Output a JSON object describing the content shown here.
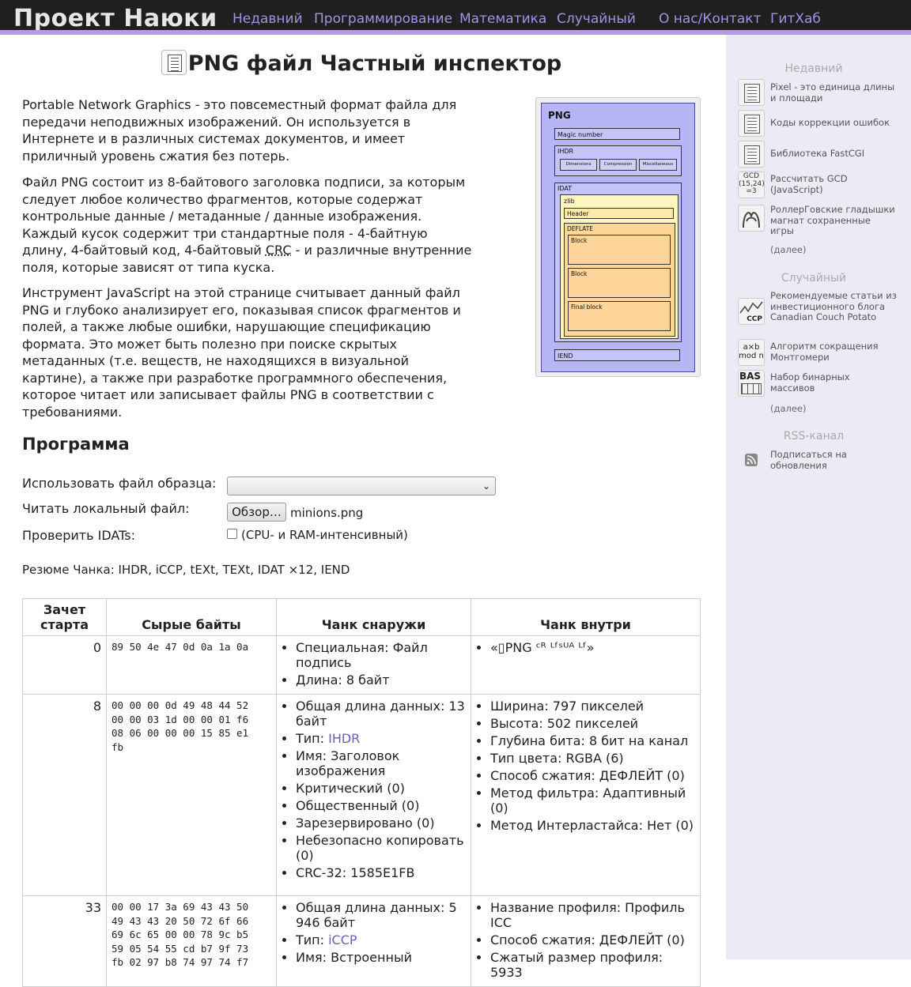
{
  "header": {
    "site_title": "Проект Наюки",
    "nav": [
      "Недавний",
      "Программирование",
      "Математика",
      "Случайный",
      "О нас/Контакт",
      "ГитХаб"
    ]
  },
  "page": {
    "title": "PNG файл Частный инспектор",
    "p1": "Portable Network Graphics - это повсеместный формат файла для передачи неподвижных изображений. Он используется в Интернете и в различных системах документов, и имеет приличный уровень сжатия без потерь.",
    "p2_before": "Файл PNG состоит из 8-байтового заголовка подписи, за которым следует любое количество фрагментов, которые содержат контрольные данные / метаданные / данные изображения. Каждый кусок содержит три стандартные поля - 4-байтную длину, 4-байтовый код, 4-байтовый ",
    "p2_abbr": "CRC",
    "p2_after": " - и различные внутренние поля, которые зависят от типа куска.",
    "p3": "Инструмент JavaScript на этой странице считывает данный файл PNG и глубоко анализирует его, показывая список фрагментов и полей, а также любые ошибки, нарушающие спецификацию формата. Это может быть полезно при поиске скрытых метаданных (т.е. веществ, не находящихся в визуальной картине), а также при разработке программного обеспечения, которое читает или записывает файлы PNG в соответствии с требованиями."
  },
  "diagram": {
    "title": "PNG",
    "magic": "Magic number",
    "ihdr": "IHDR",
    "ihdr_fields": [
      "Dimensions",
      "Compression",
      "Miscellaneous"
    ],
    "idat": "IDAT",
    "zlib": "zlib",
    "header": "Header",
    "deflate": "DEFLATE",
    "blocks": [
      "Block",
      "Block",
      "Final block"
    ],
    "iend": "IEND"
  },
  "program": {
    "heading": "Программа",
    "sample_label": "Использовать файл образца:",
    "sample_value": "",
    "local_label": "Читать локальный файл:",
    "browse_label": "Обзор…",
    "file_name": "minions.png",
    "idat_label": "Проверить IDATs:",
    "idat_note": "(CPU- и RAM-интенсивный)",
    "summary": "Резюме Чанка: IHDR, iCCP, tEXt, TEXt, IDAT ×12, IEND"
  },
  "table": {
    "headers": [
      "Зачет старта",
      "Сырые байты",
      "Чанк снаружи",
      "Чанк внутри"
    ],
    "rows": [
      {
        "offset": "0",
        "raw": "89 50 4e 47 0d 0a 1a 0a",
        "outside": [
          "Специальная: Файл подпись",
          "Длина: 8 байт"
        ],
        "inside": [
          "«▯PNG ᶜᴿ ᴸᶠˢᵁᴬ ᴸᶠ»"
        ]
      },
      {
        "offset": "8",
        "raw": "00 00 00 0d 49 48 44 52\n00 00 03 1d 00 00 01 f6\n08 06 00 00 00 15 85 e1\nfb",
        "outside_len": "Общая длина данных: 13 байт",
        "outside_type_label": "Тип: ",
        "outside_type_link": "IHDR",
        "outside_rest": [
          "Имя: Заголовок изображения",
          "Критический (0)",
          "Общественный (0)",
          "Зарезервировано (0)",
          "Небезопасно копировать (0)",
          "CRC-32: 1585E1FB"
        ],
        "inside": [
          "Ширина: 797 пикселей",
          "Высота: 502 пикселей",
          "Глубина бита: 8 бит на канал",
          "Тип цвета: RGBA (6)",
          "Способ сжатия: ДЕФЛЕЙТ (0)",
          "Метод фильтра: Адаптивный (0)",
          "Метод Интерластайса: Нет (0)"
        ]
      },
      {
        "offset": "33",
        "raw": "00 00 17 3a 69 43 43 50\n49 43 43 20 50 72 6f 66\n69 6c 65 00 00 78 9c b5\n59 05 54 55 cd b7 9f 73\nfb 02 97 b8 74 97 74 f7",
        "outside_len": "Общая длина данных: 5 946 байт",
        "outside_type_label": "Тип: ",
        "outside_type_link": "iCCP",
        "outside_rest": [
          "Имя: Встроенный"
        ],
        "inside": [
          "Название профиля: Профиль ICC",
          "Способ сжатия: ДЕФЛЕЙТ (0)",
          "Сжатый размер профиля: 5933"
        ]
      }
    ]
  },
  "sidebar": {
    "recent_heading": "Недавний",
    "recent": [
      {
        "icon": "document-icon",
        "label": "Pixel - это единица длины и площади"
      },
      {
        "icon": "document-icon",
        "label": "Коды коррекции ошибок"
      },
      {
        "icon": "document-icon",
        "label": "Библиотека FastCGI"
      },
      {
        "icon": "gcd-icon",
        "icon_text": "GCD\n(15,24)\n=3",
        "label": "Рассчитать GCD (JavaScript)"
      },
      {
        "icon": "roller-coaster-icon",
        "label": "РоллерГовские гладышки магнат сохраненные игры"
      }
    ],
    "random_heading": "Случайный",
    "random": [
      {
        "icon": "ccp-chart-icon",
        "icon_text": "CCP",
        "label": "Рекомендуемые статьи из инвестиционного блога Canadian Couch Potato"
      },
      {
        "icon": "montgomery-icon",
        "icon_text": "a×b\nmod n",
        "label": "Алгоритм сокращения Монтгомери"
      },
      {
        "icon": "binary-array-icon",
        "icon_text": "BAS",
        "label": "Набор бинарных массивов"
      }
    ],
    "more": "(далее)",
    "rss_heading": "RSS-канал",
    "rss_label": "Подписаться на обновления"
  }
}
